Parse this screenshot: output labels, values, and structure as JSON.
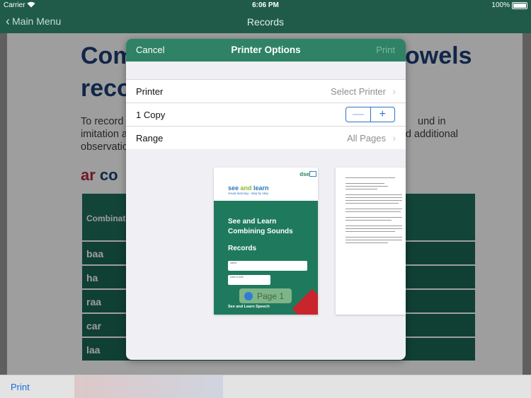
{
  "status_bar": {
    "carrier": "Carrier",
    "wifi_icon": "wifi-icon",
    "time": "6:06 PM",
    "battery_percent": "100%"
  },
  "nav": {
    "back_label": "Main Menu",
    "title": "Records"
  },
  "background_doc": {
    "heading_line1_left": "Com",
    "heading_line1_right": "owels",
    "heading_line2": "reco",
    "para_line1_left": "To record",
    "para_line1_right": "und in",
    "para_line2_left": "imitation a",
    "para_line2_right": "rd additional",
    "para_line3": "observatio",
    "sub_ar": "ar",
    "sub_co": "co",
    "table_header": "Combinati",
    "table_rows": [
      "baa",
      "ha",
      "raa",
      "car",
      "laa"
    ]
  },
  "modal": {
    "cancel_label": "Cancel",
    "title": "Printer Options",
    "print_label": "Print",
    "printer_label": "Printer",
    "printer_value": "Select Printer",
    "copies_label": "1 Copy",
    "minus": "—",
    "plus": "+",
    "range_label": "Range",
    "range_value": "All Pages",
    "preview": {
      "dse": "dse",
      "brand_see": "see ",
      "brand_and": "and",
      "brand_learn": " learn",
      "tagline": "visual learning - step by step",
      "title_line1": "See and Learn",
      "title_line2": "Combining Sounds",
      "subtitle": "Records",
      "field1": "Name",
      "field2": "Date of birth",
      "footer": "See and Learn Speech",
      "page_badge": "Page 1"
    }
  },
  "bottom_toolbar": {
    "print_label": "Print"
  }
}
